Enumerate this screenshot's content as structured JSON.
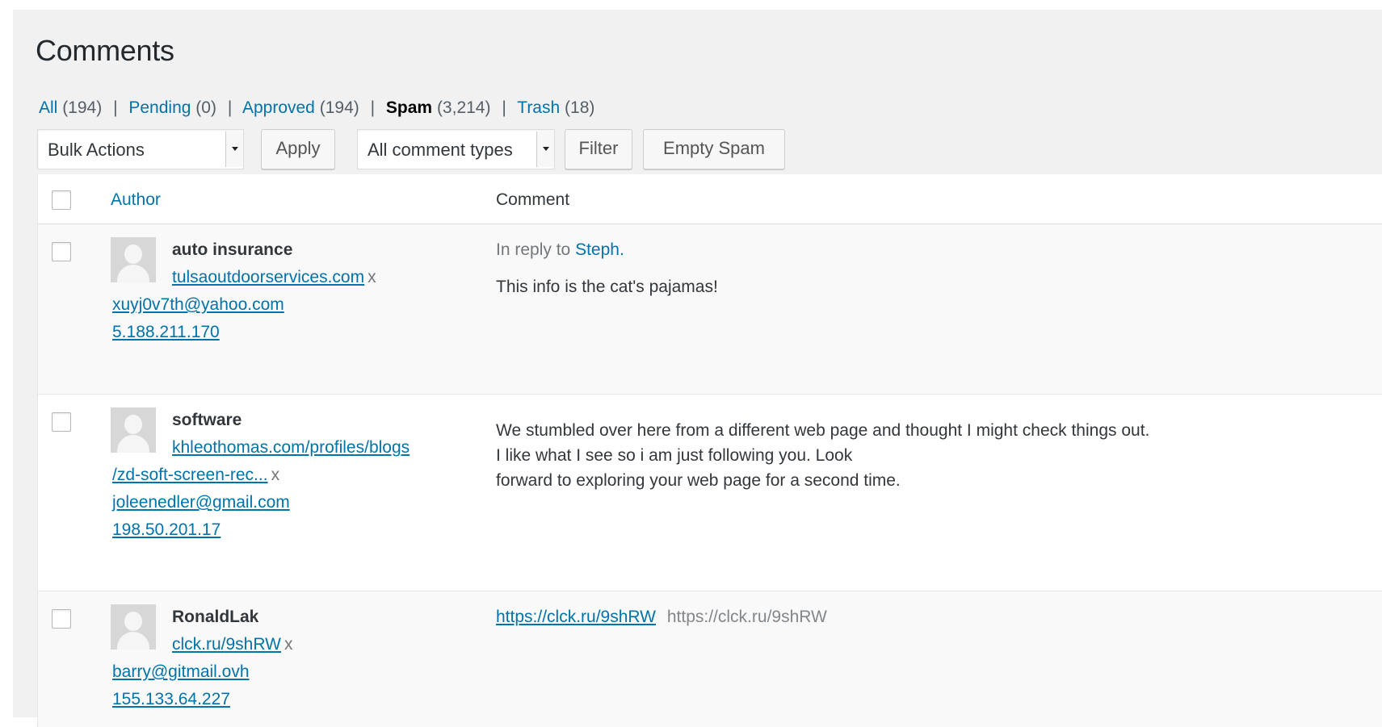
{
  "page": {
    "title": "Comments"
  },
  "filters": {
    "all": {
      "label": "All",
      "count": "(194)"
    },
    "pending": {
      "label": "Pending",
      "count": "(0)"
    },
    "approved": {
      "label": "Approved",
      "count": "(194)"
    },
    "spam": {
      "label": "Spam",
      "count": "(3,214)"
    },
    "trash": {
      "label": "Trash",
      "count": "(18)"
    },
    "separator": "|"
  },
  "toolbar": {
    "bulk_actions": "Bulk Actions",
    "apply": "Apply",
    "comment_types": "All comment types",
    "filter": "Filter",
    "empty_spam": "Empty Spam"
  },
  "table": {
    "headers": {
      "author": "Author",
      "comment": "Comment"
    },
    "rows": [
      {
        "author_name": "auto insurance",
        "author_url": "tulsaoutdoorservices.com",
        "remove_mark": "x",
        "email": "xuyj0v7th@yahoo.com",
        "ip": "5.188.211.170",
        "reply_prefix": "In reply to",
        "reply_to": "Steph.",
        "comment_lines": [
          "This info is the cat's pajamas!"
        ]
      },
      {
        "author_name": "software",
        "author_url_1": "khleothomas.com/profiles/blogs",
        "author_url_2": "/zd-soft-screen-rec...",
        "remove_mark": "x",
        "email": "joleenedler@gmail.com",
        "ip": "198.50.201.17",
        "comment_lines": [
          "We stumbled over here from a different web page and thought I might check things out.",
          "I like what I see so i am just following you. Look",
          "forward to exploring your web page for a second time."
        ]
      },
      {
        "author_name": "RonaldLak",
        "author_url": "clck.ru/9shRW",
        "remove_mark": "x",
        "email": "barry@gitmail.ovh",
        "ip": "155.133.64.227",
        "comment_link": "https://clck.ru/9shRW",
        "comment_plain": "https://clck.ru/9shRW"
      }
    ]
  },
  "colors": {
    "link": "#0073aa",
    "text": "#23282d",
    "background": "#f1f1f1"
  }
}
